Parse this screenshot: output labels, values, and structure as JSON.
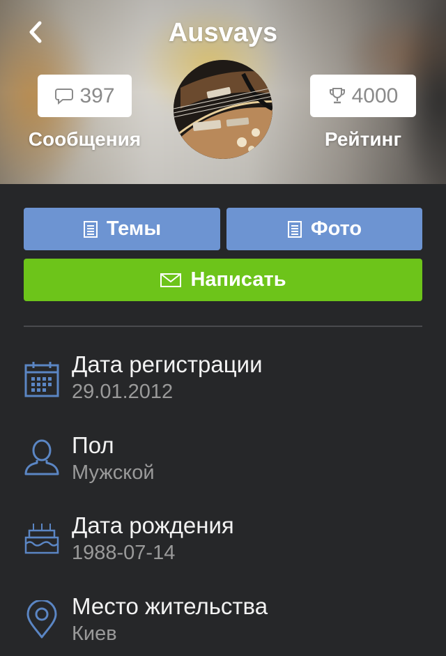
{
  "header": {
    "title": "Ausvays",
    "messages": {
      "count": "397",
      "label": "Сообщения",
      "icon": "chat-bubble-icon"
    },
    "rating": {
      "count": "4000",
      "label": "Рейтинг",
      "icon": "trophy-icon"
    },
    "back_icon": "chevron-left-icon"
  },
  "actions": {
    "topics_label": "Темы",
    "photo_label": "Фото",
    "write_label": "Написать"
  },
  "info": [
    {
      "label": "Дата регистрации",
      "value": "29.01.2012",
      "icon": "calendar-icon"
    },
    {
      "label": "Пол",
      "value": "Мужской",
      "icon": "person-icon"
    },
    {
      "label": "Дата рождения",
      "value": "1988-07-14",
      "icon": "birthday-cake-icon"
    },
    {
      "label": "Место жительства",
      "value": "Киев",
      "icon": "location-pin-icon"
    }
  ],
  "colors": {
    "background": "#262729",
    "primary_button": "#6d94d2",
    "write_button": "#6dc41a",
    "icon_accent": "#5b86c4",
    "label_text": "#f2f2f2",
    "value_text": "#9a9a9a"
  }
}
